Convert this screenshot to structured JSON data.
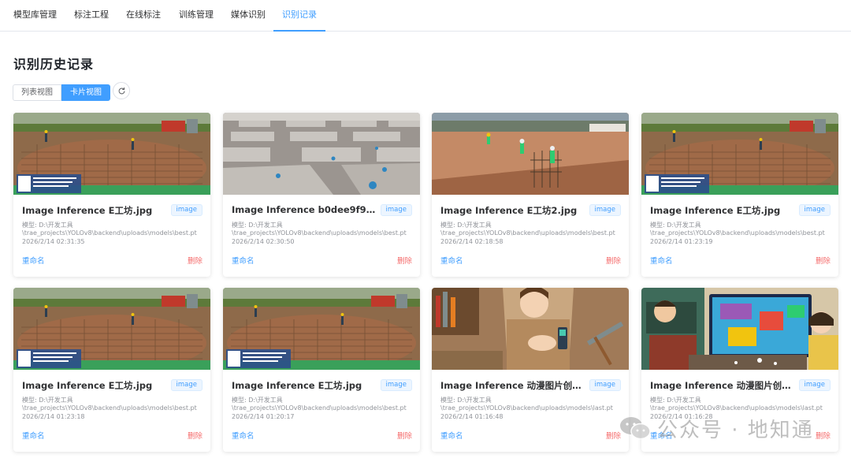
{
  "nav": {
    "items": [
      {
        "label": "模型库管理",
        "active": false
      },
      {
        "label": "标注工程",
        "active": false
      },
      {
        "label": "在线标注",
        "active": false
      },
      {
        "label": "训练管理",
        "active": false
      },
      {
        "label": "媒体识别",
        "active": false
      },
      {
        "label": "识别记录",
        "active": true
      }
    ]
  },
  "page": {
    "title": "识别历史记录",
    "list_view_label": "列表视图",
    "card_view_label": "卡片视图",
    "refresh_icon": "refresh-icon"
  },
  "colors": {
    "accent": "#409eff",
    "danger": "#f56c6c",
    "text": "#303133",
    "muted": "#909399"
  },
  "cards": [
    {
      "title": "Image Inference E工坊.jpg",
      "tag": "image",
      "model_label": "模型: D:\\开发工具",
      "model_path": "\\trae_projects\\YOLOv8\\backend\\uploads\\models\\best.pt",
      "time": "2026/2/14 02:31:35",
      "rename": "重命名",
      "delete": "删除",
      "thumb": "construction-site"
    },
    {
      "title": "Image Inference b0dee9f9ea346...",
      "tag": "image",
      "model_label": "模型: D:\\开发工具",
      "model_path": "\\trae_projects\\YOLOv8\\backend\\uploads\\models\\best.pt",
      "time": "2026/2/14 02:30:50",
      "rename": "重命名",
      "delete": "删除",
      "thumb": "concrete-slabs"
    },
    {
      "title": "Image Inference E工坊2.jpg",
      "tag": "image",
      "model_label": "模型: D:\\开发工具",
      "model_path": "\\trae_projects\\YOLOv8\\backend\\uploads\\models\\best.pt",
      "time": "2026/2/14 02:18:58",
      "rename": "重命名",
      "delete": "删除",
      "thumb": "excavation-workers"
    },
    {
      "title": "Image Inference E工坊.jpg",
      "tag": "image",
      "model_label": "模型: D:\\开发工具",
      "model_path": "\\trae_projects\\YOLOv8\\backend\\uploads\\models\\best.pt",
      "time": "2026/2/14 01:23:19",
      "rename": "重命名",
      "delete": "删除",
      "thumb": "construction-site"
    },
    {
      "title": "Image Inference E工坊.jpg",
      "tag": "image",
      "model_label": "模型: D:\\开发工具",
      "model_path": "\\trae_projects\\YOLOv8\\backend\\uploads\\models\\best.pt",
      "time": "2026/2/14 01:23:18",
      "rename": "重命名",
      "delete": "删除",
      "thumb": "construction-site"
    },
    {
      "title": "Image Inference E工坊.jpg",
      "tag": "image",
      "model_label": "模型: D:\\开发工具",
      "model_path": "\\trae_projects\\YOLOv8\\backend\\uploads\\models\\best.pt",
      "time": "2026/2/14 01:20:17",
      "rename": "重命名",
      "delete": "删除",
      "thumb": "construction-site"
    },
    {
      "title": "Image Inference 动漫图片创作 (29...",
      "tag": "image",
      "model_label": "模型: D:\\开发工具",
      "model_path": "\\trae_projects\\YOLOv8\\backend\\uploads\\models\\last.pt",
      "time": "2026/2/14 01:16:48",
      "rename": "重命名",
      "delete": "删除",
      "thumb": "anime-geologist"
    },
    {
      "title": "Image Inference 动漫图片创作 (16...",
      "tag": "image",
      "model_label": "模型: D:\\开发工具",
      "model_path": "\\trae_projects\\YOLOv8\\backend\\uploads\\models\\last.pt",
      "time": "2026/2/14 01:16:28",
      "rename": "重命名",
      "delete": "删除",
      "thumb": "anime-classroom"
    }
  ],
  "watermark": {
    "text": "公众号 · 地知通",
    "icon": "wechat-icon"
  }
}
